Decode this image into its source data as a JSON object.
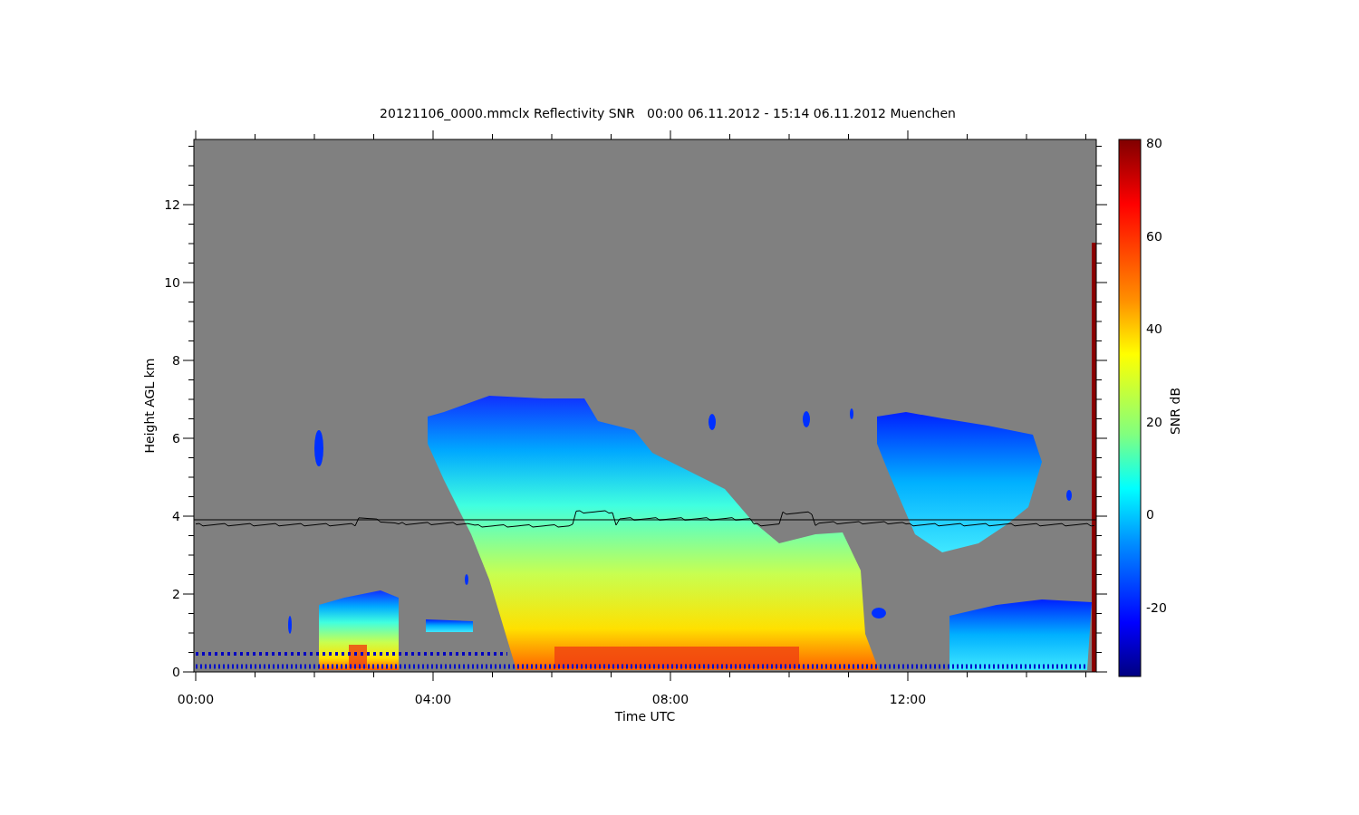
{
  "title": "20121106_0000.mmclx Reflectivity SNR   00:00 06.11.2012 - 15:14 06.11.2012 Muenchen",
  "y_axis": {
    "label": "Height AGL km",
    "ticks": [
      "12",
      "10",
      "8",
      "6",
      "4",
      "2",
      "0"
    ]
  },
  "x_axis": {
    "label": "Time UTC",
    "ticks": [
      "00:00",
      "04:00",
      "08:00",
      "12:00"
    ]
  },
  "colorbar": {
    "label": "SNR dB",
    "ticks": [
      "80",
      "60",
      "40",
      "20",
      "0",
      "-20"
    ]
  }
}
